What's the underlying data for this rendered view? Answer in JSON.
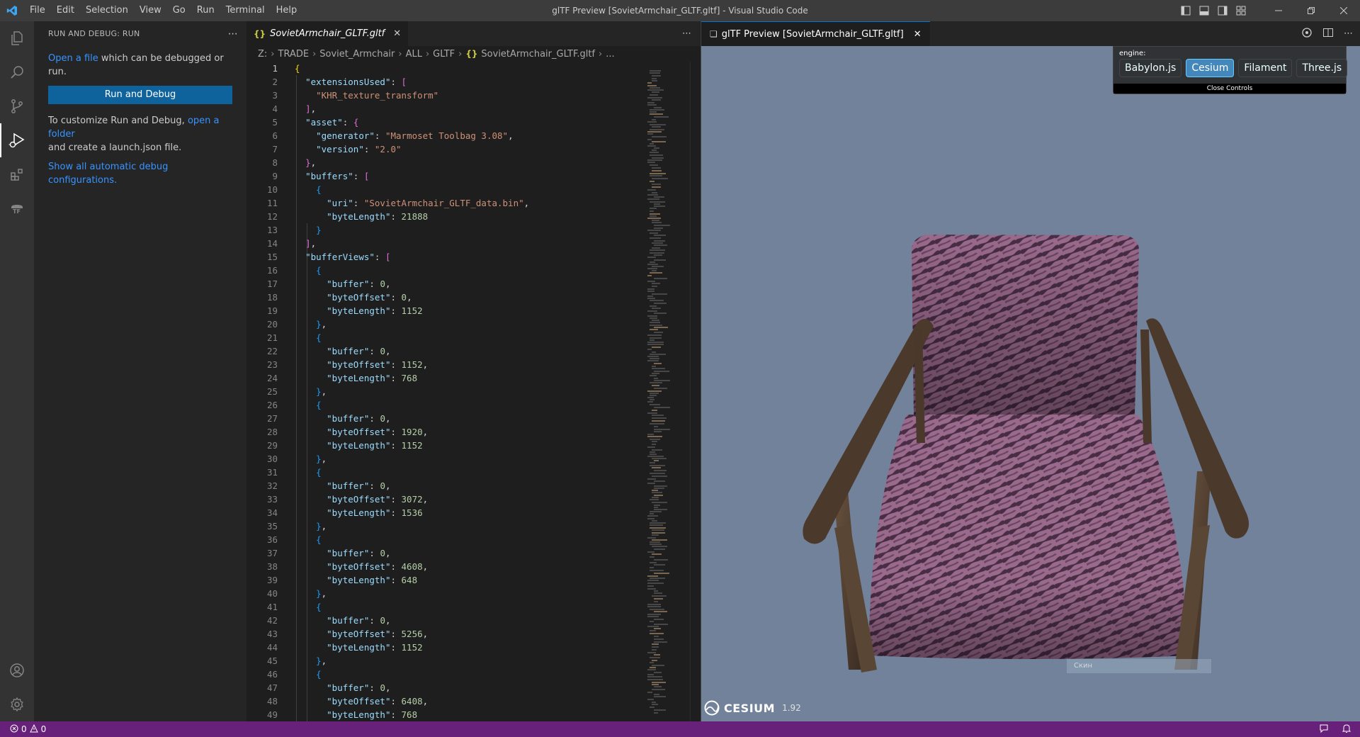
{
  "titlebar": {
    "menu": [
      "File",
      "Edit",
      "Selection",
      "View",
      "Go",
      "Run",
      "Terminal",
      "Help"
    ],
    "title": "glTF Preview [SovietArmchair_GLTF.gltf] - Visual Studio Code"
  },
  "activitybar": {
    "items": [
      "explorer-icon",
      "search-icon",
      "source-control-icon",
      "run-debug-icon",
      "extensions-icon",
      "tf-icon"
    ],
    "bottom": [
      "account-icon",
      "gear-icon"
    ]
  },
  "sidebar": {
    "title": "RUN AND DEBUG: RUN",
    "open_file_link": "Open a file",
    "open_file_rest": " which can be debugged or run.",
    "run_button": "Run and Debug",
    "customize_text": "To customize Run and Debug, ",
    "open_folder_link": "open a folder",
    "customize_rest": "and create a launch.json file.",
    "show_all_link": "Show all automatic debug configurations."
  },
  "editor": {
    "tab_label": "SovietArmchair_GLTF.gltf",
    "breadcrumb": [
      "Z:",
      "TRADE",
      "Soviet_Armchair",
      "ALL",
      "GLTF"
    ],
    "breadcrumb_file": "SovietArmchair_GLTF.gltf",
    "breadcrumb_tail": "...",
    "lines": [
      "{",
      "  \"extensionsUsed\": [",
      "    \"KHR_texture_transform\"",
      "  ],",
      "  \"asset\": {",
      "    \"generator\": \"Marmoset Toolbag 3.08\",",
      "    \"version\": \"2.0\"",
      "  },",
      "  \"buffers\": [",
      "    {",
      "      \"uri\": \"SovietArmchair_GLTF_data.bin\",",
      "      \"byteLength\": 21888",
      "    }",
      "  ],",
      "  \"bufferViews\": [",
      "    {",
      "      \"buffer\": 0,",
      "      \"byteOffset\": 0,",
      "      \"byteLength\": 1152",
      "    },",
      "    {",
      "      \"buffer\": 0,",
      "      \"byteOffset\": 1152,",
      "      \"byteLength\": 768",
      "    },",
      "    {",
      "      \"buffer\": 0,",
      "      \"byteOffset\": 1920,",
      "      \"byteLength\": 1152",
      "    },",
      "    {",
      "      \"buffer\": 0,",
      "      \"byteOffset\": 3072,",
      "      \"byteLength\": 1536",
      "    },",
      "    {",
      "      \"buffer\": 0,",
      "      \"byteOffset\": 4608,",
      "      \"byteLength\": 648",
      "    },",
      "    {",
      "      \"buffer\": 0,",
      "      \"byteOffset\": 5256,",
      "      \"byteLength\": 1152",
      "    },",
      "    {",
      "      \"buffer\": 0,",
      "      \"byteOffset\": 6408,",
      "      \"byteLength\": 768"
    ]
  },
  "preview": {
    "tab_label": "glTF Preview [SovietArmchair_GLTF.gltf]",
    "engine_label": "engine:",
    "engines": [
      "Babylon.js",
      "Cesium",
      "Filament",
      "Three.js"
    ],
    "active_engine": "Cesium",
    "close_controls": "Close Controls",
    "credit_logo": "CESIUM",
    "credit_version": "1.92",
    "ghost_label": "Скин"
  },
  "statusbar": {
    "errors": "0",
    "warnings": "0"
  },
  "colors": {
    "accent": "#0078d4",
    "statusbar": "#68217a",
    "viewport_bg": "#71829a",
    "button": "#0e639c"
  }
}
